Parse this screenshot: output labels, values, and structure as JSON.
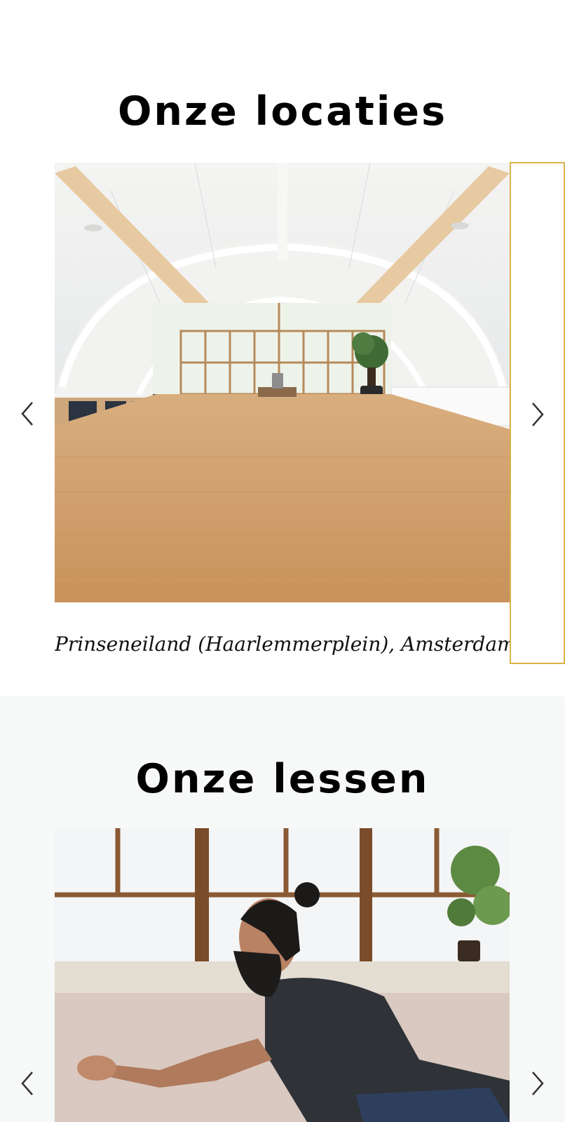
{
  "locations": {
    "title": "Onze locaties",
    "slide": {
      "caption": "Prinseneiland (Haarlemmerplein), Amsterdam",
      "image": "studio-arched-room-photo"
    },
    "prev_icon": "chevron-left-icon",
    "next_icon": "chevron-right-icon"
  },
  "classes": {
    "title": "Onze lessen",
    "slide": {
      "image": "man-stretching-photo"
    },
    "prev_icon": "chevron-left-icon",
    "next_icon": "chevron-right-icon"
  },
  "colors": {
    "accent_border": "#d9b24a",
    "section_alt_bg": "#f7f8f8"
  }
}
